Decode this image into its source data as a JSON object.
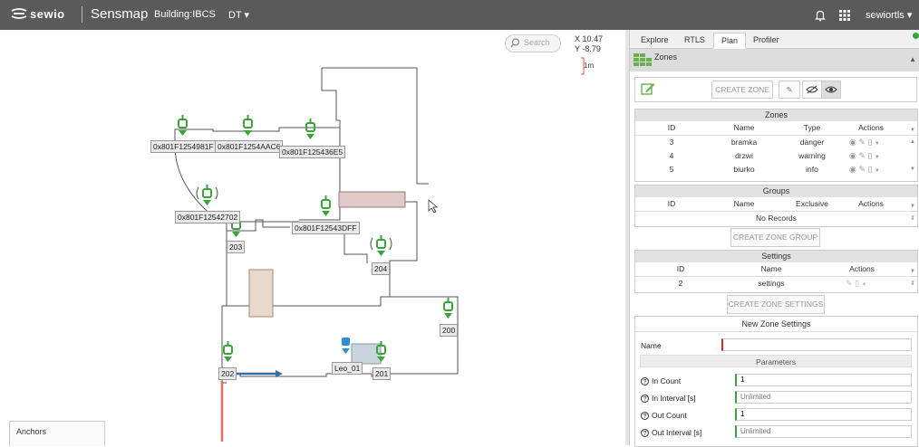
{
  "topbar": {
    "logo": "sewio",
    "app_name": "Sensmap",
    "building": "Building:IBCS",
    "dt_menu": "DT",
    "user": "sewiortls"
  },
  "map": {
    "search_placeholder": "Search",
    "coord_x": "X 10.47",
    "coord_y": "Y -8.79",
    "scale_label": "1m",
    "anchors_label": "Anchors",
    "anchors": [
      "0x801F1254981F",
      "0x801F1254AAC6",
      "0x801F125436E5",
      "0x801F12542702",
      "0x801F12543DFF"
    ],
    "tags": [
      "203",
      "204",
      "200",
      "202",
      "201",
      "Leo_01"
    ]
  },
  "panel": {
    "tabs": [
      "Explore",
      "RTLS",
      "Plan",
      "Profiler"
    ],
    "active_tab": "Plan",
    "zones_header": "Zones",
    "create_zone": "CREATE ZONE",
    "zones_table": {
      "title": "Zones",
      "columns": [
        "ID",
        "Name",
        "Type",
        "Actions"
      ],
      "rows": [
        {
          "id": "3",
          "name": "bramka",
          "type": "danger"
        },
        {
          "id": "4",
          "name": "drzwi",
          "type": "warning"
        },
        {
          "id": "5",
          "name": "biurko",
          "type": "info"
        }
      ]
    },
    "groups_table": {
      "title": "Groups",
      "columns": [
        "ID",
        "Name",
        "Exclusive",
        "Actions"
      ],
      "empty": "No Records"
    },
    "create_zone_group": "CREATE ZONE GROUP",
    "settings_table": {
      "title": "Settings",
      "columns": [
        "ID",
        "Name",
        "Actions"
      ],
      "rows": [
        {
          "id": "2",
          "name": "settings"
        }
      ]
    },
    "create_zone_settings": "CREATE ZONE SETTINGS",
    "form": {
      "title": "New Zone Settings",
      "name_label": "Name",
      "name_value": "",
      "parameters_label": "Parameters",
      "in_count_label": "In Count",
      "in_count_value": "1",
      "in_interval_label": "In Interval [s]",
      "in_interval_placeholder": "Unlimited",
      "out_count_label": "Out Count",
      "out_count_value": "1",
      "out_interval_label": "Out Interval [s]",
      "out_interval_placeholder": "Unlimited"
    }
  },
  "colors": {
    "anchor_green": "#3aa33a",
    "tag_blue": "#2c8fd6",
    "topbar": "#5a5a5a"
  }
}
